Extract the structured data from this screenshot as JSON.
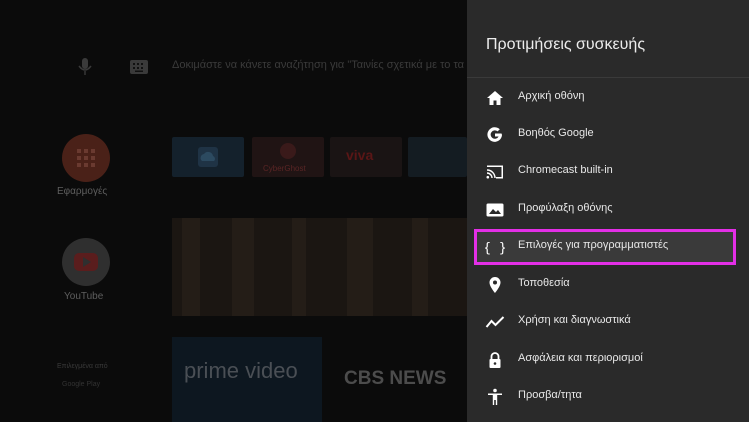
{
  "home": {
    "search_hint": "Δοκιμάστε να κάνετε αναζήτηση για \"Ταινίες σχετικά με το τα",
    "apps_label": "Εφαρμογές",
    "youtube_label": "YouTube",
    "sponsored_label": "Επιλεγμένα από",
    "google_play_label": "Google Play",
    "tile_cyberghost": "CyberGhost",
    "tile_viva": "viva",
    "prime_video": "prime video",
    "cbs_news": "CBS NEWS"
  },
  "panel": {
    "title": "Προτιμήσεις συσκευής",
    "focused_index": 4,
    "items": [
      {
        "label": "Αρχική οθόνη",
        "icon": "home-icon"
      },
      {
        "label": "Βοηθός Google",
        "icon": "google-g-icon"
      },
      {
        "label": "Chromecast built-in",
        "icon": "cast-icon"
      },
      {
        "label": "Προφύλαξη οθόνης",
        "icon": "screensaver-icon"
      },
      {
        "label": "Επιλογές για προγραμματιστές",
        "icon": "developer-braces-icon"
      },
      {
        "label": "Τοποθεσία",
        "icon": "location-pin-icon"
      },
      {
        "label": "Χρήση και διαγνωστικά",
        "icon": "diagnostics-trend-icon"
      },
      {
        "label": "Ασφάλεια και περιορισμοί",
        "icon": "lock-icon"
      },
      {
        "label": "Προσβα/τητα",
        "icon": "accessibility-icon"
      }
    ]
  },
  "colors": {
    "panel_bg": "#2a2a2a",
    "focus_outline": "#e32fe6",
    "text": "#e8e8e8"
  }
}
